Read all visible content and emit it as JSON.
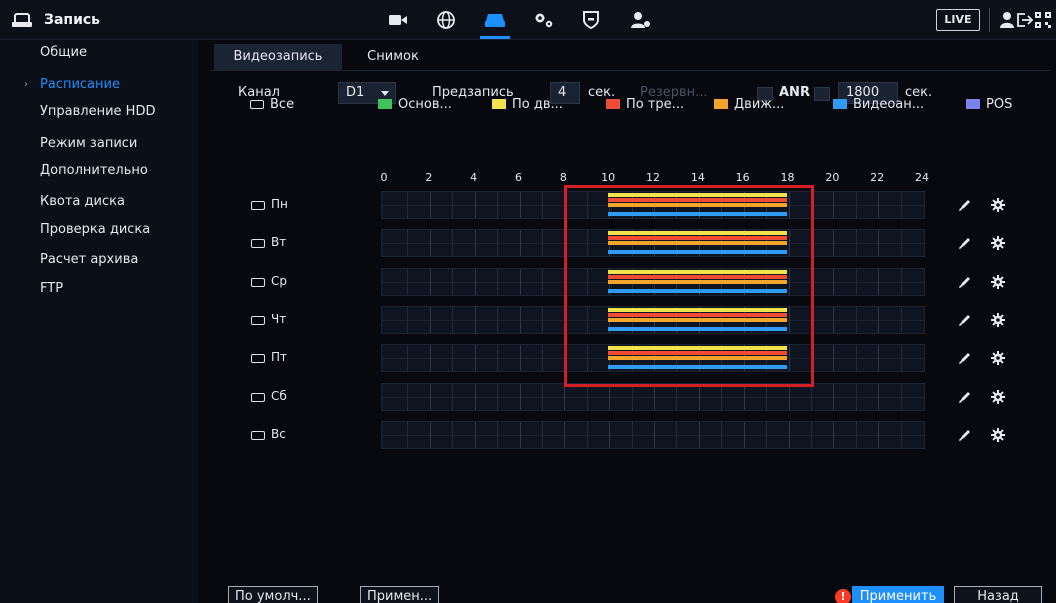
{
  "header": {
    "title": "Запись",
    "live_label": "LIVE",
    "nav_icons": [
      "camera-icon",
      "globe-icon",
      "storage-icon",
      "settings-icon",
      "shield-icon",
      "account-icon"
    ],
    "active_nav": "storage-icon",
    "accent_color": "#1e8fff"
  },
  "sidebar": {
    "items": [
      {
        "label": "Общие",
        "active": false
      },
      {
        "label": "Расписание",
        "active": true
      },
      {
        "label": "Управление HDD",
        "active": false
      },
      {
        "label": "Режим записи",
        "active": false
      },
      {
        "label": "Дополнительно",
        "active": false
      },
      {
        "label": "Квота диска",
        "active": false
      },
      {
        "label": "Проверка диска",
        "active": false
      },
      {
        "label": "Расчет архива",
        "active": false
      },
      {
        "label": "FTP",
        "active": false
      }
    ]
  },
  "tabs": [
    {
      "label": "Видеозапись",
      "active": true
    },
    {
      "label": "Снимок",
      "active": false
    }
  ],
  "controls": {
    "channel_label": "Канал",
    "channel_value": "D1",
    "prerecord_label": "Предзапись",
    "prerecord_value": "4",
    "sec_label": "сек.",
    "reserve_label": "Резервн...",
    "anr_label": "ANR",
    "anr_value": "1800",
    "anr_sec_label": "сек."
  },
  "legend": {
    "all_label": "Все",
    "items": [
      {
        "label": "Основ...",
        "color": "#3fc35a",
        "checked": true
      },
      {
        "label": "По дв...",
        "color": "#f3e34a"
      },
      {
        "label": "По тре...",
        "color": "#ef4b35"
      },
      {
        "label": "Движ...",
        "color": "#f2a52a"
      },
      {
        "label": "Видеоан...",
        "color": "#2e9bf5"
      },
      {
        "label": "POS",
        "color": "#7d82f0"
      }
    ]
  },
  "schedule": {
    "hours": [
      "0",
      "2",
      "4",
      "6",
      "8",
      "10",
      "12",
      "14",
      "16",
      "18",
      "20",
      "22",
      "24"
    ],
    "days": [
      {
        "label": "Пн",
        "record_start_hour": 10,
        "record_end_hour": 18
      },
      {
        "label": "Вт",
        "record_start_hour": 10,
        "record_end_hour": 18
      },
      {
        "label": "Ср",
        "record_start_hour": 10,
        "record_end_hour": 18
      },
      {
        "label": "Чт",
        "record_start_hour": 10,
        "record_end_hour": 18
      },
      {
        "label": "Пт",
        "record_start_hour": 10,
        "record_end_hour": 18
      },
      {
        "label": "Сб",
        "record_start_hour": null,
        "record_end_hour": null
      },
      {
        "label": "Вс",
        "record_start_hour": null,
        "record_end_hour": null
      }
    ],
    "bar_colors": [
      "#f3e34a",
      "#ef4b35",
      "#f2a52a",
      "#2e9bf5"
    ],
    "highlight_color": "#d51f25"
  },
  "footer": {
    "default_label": "По умолч...",
    "copy_label": "Примен...",
    "apply_label": "Применить",
    "back_label": "Назад",
    "warning_glyph": "!"
  }
}
